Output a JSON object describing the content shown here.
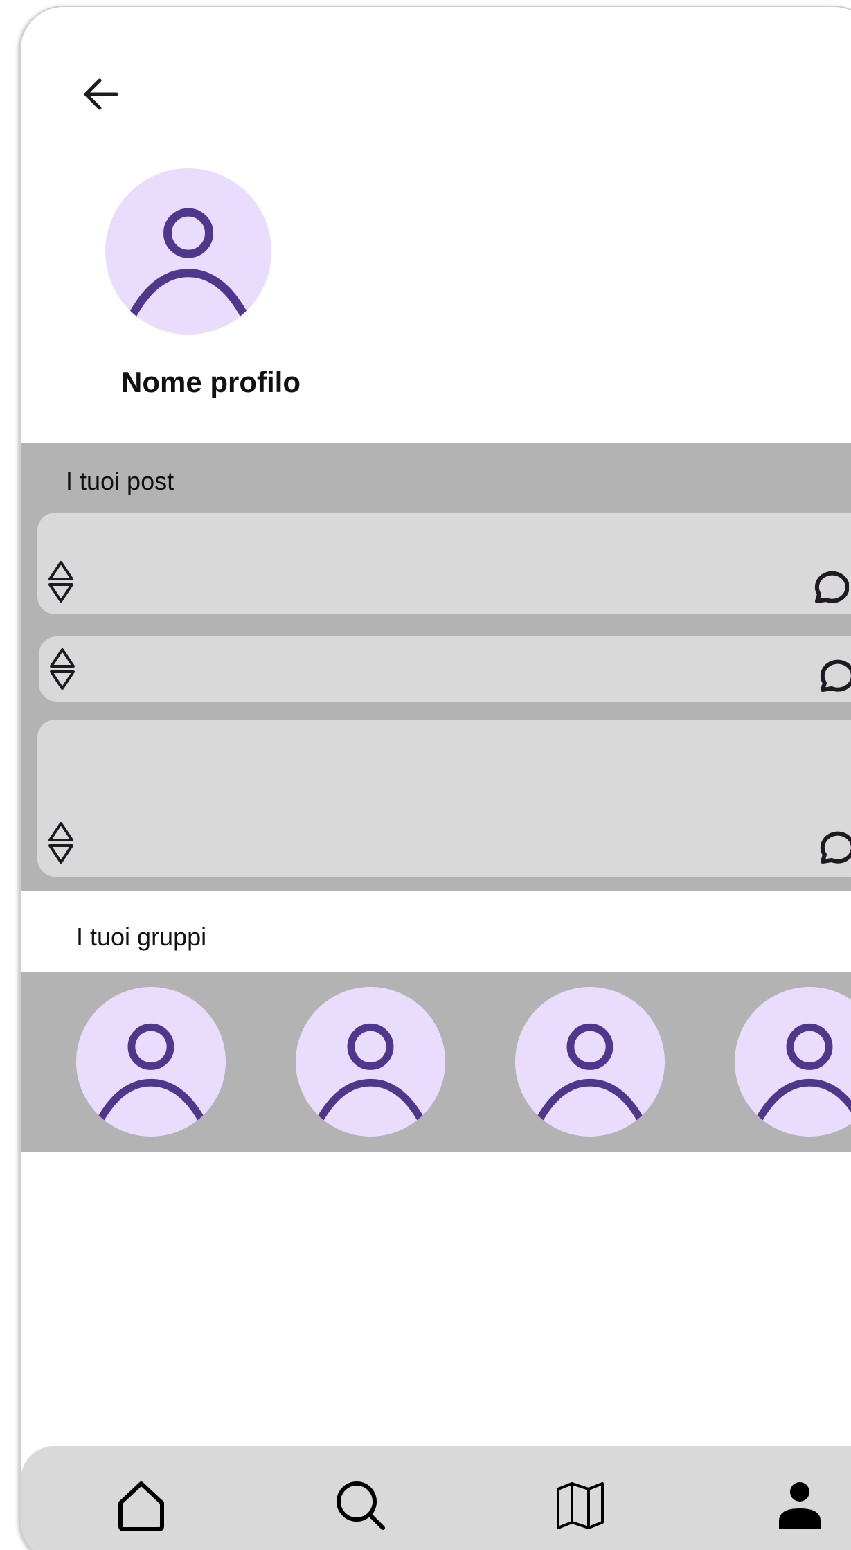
{
  "header": {
    "back_icon": "arrow-left-icon"
  },
  "profile": {
    "name": "Nome profilo",
    "avatar_icon": "user-avatar-icon"
  },
  "posts": {
    "title": "I tuoi post",
    "items": [
      {
        "vote_icon": "up-down-vote-icon",
        "comment_icon": "comment-bubble-icon"
      },
      {
        "vote_icon": "up-down-vote-icon",
        "comment_icon": "comment-bubble-icon"
      },
      {
        "vote_icon": "up-down-vote-icon",
        "comment_icon": "comment-bubble-icon"
      }
    ]
  },
  "groups": {
    "title": "I tuoi gruppi",
    "items": [
      {
        "avatar_icon": "user-avatar-icon"
      },
      {
        "avatar_icon": "user-avatar-icon"
      },
      {
        "avatar_icon": "user-avatar-icon"
      },
      {
        "avatar_icon": "user-avatar-icon"
      }
    ]
  },
  "bottom_nav": {
    "items": [
      {
        "icon": "home-icon"
      },
      {
        "icon": "search-icon"
      },
      {
        "icon": "map-icon"
      },
      {
        "icon": "profile-icon"
      }
    ]
  },
  "colors": {
    "avatar_bg": "#eadcfc",
    "avatar_fg": "#4f378b",
    "section_bg": "#b3b3b3",
    "card_bg": "#d9d9d9"
  }
}
